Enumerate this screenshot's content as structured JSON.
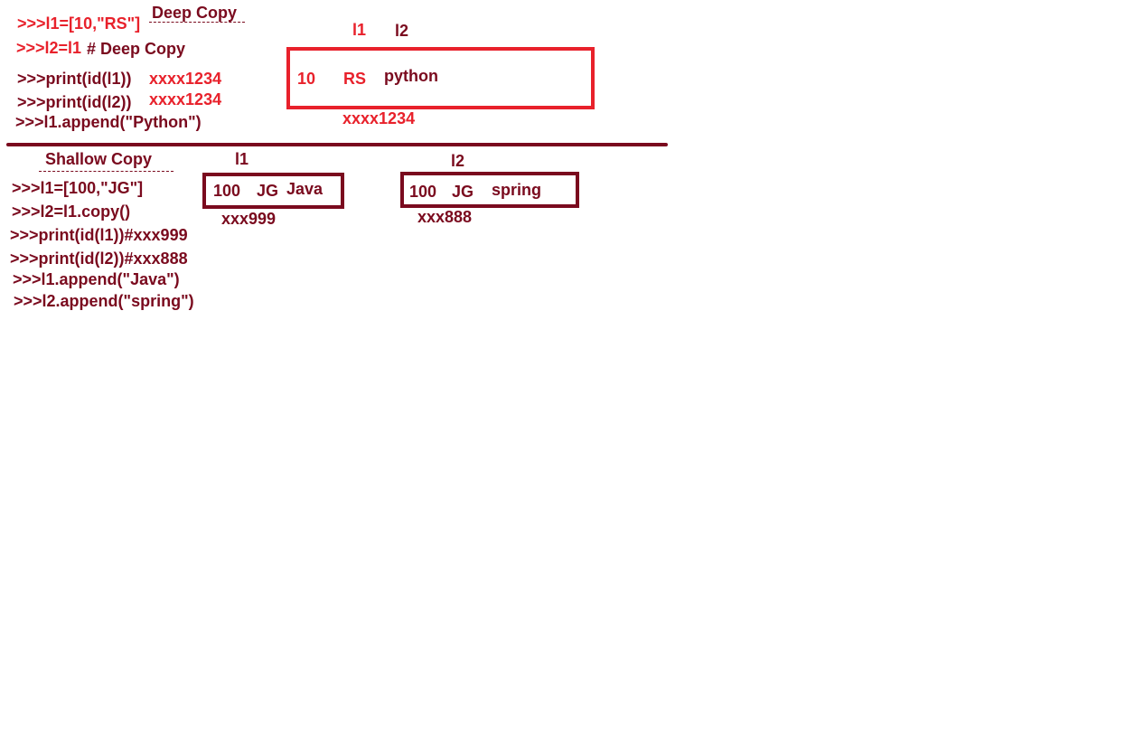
{
  "deep": {
    "title": "Deep Copy",
    "code": {
      "line1": ">>>l1=[10,\"RS\"]",
      "line2": ">>>l2=l1",
      "line2_comment": "# Deep Copy",
      "line3": ">>>print(id(l1))",
      "line3_id": "xxxx1234",
      "line4": ">>>print(id(l2))",
      "line4_id": "xxxx1234",
      "line5": ">>>l1.append(\"Python\")"
    },
    "diagram": {
      "label_l1": "l1",
      "label_l2": "l2",
      "items": [
        "10",
        "RS",
        "python"
      ],
      "address": "xxxx1234"
    }
  },
  "shallow": {
    "title": "Shallow Copy",
    "code": {
      "line1": ">>>l1=[100,\"JG\"]",
      "line2": ">>>l2=l1.copy()",
      "line3": ">>>print(id(l1))#xxx999",
      "line4": ">>>print(id(l2))#xxx888",
      "line5": ">>>l1.append(\"Java\")",
      "line6": ">>>l2.append(\"spring\")"
    },
    "list1": {
      "label": "l1",
      "items": [
        "100",
        "JG",
        "Java"
      ],
      "address": "xxx999"
    },
    "list2": {
      "label": "l2",
      "items": [
        "100",
        "JG",
        "spring"
      ],
      "address": "xxx888"
    }
  },
  "colors": {
    "red": "#e8212b",
    "dark": "#7a0a1e"
  }
}
